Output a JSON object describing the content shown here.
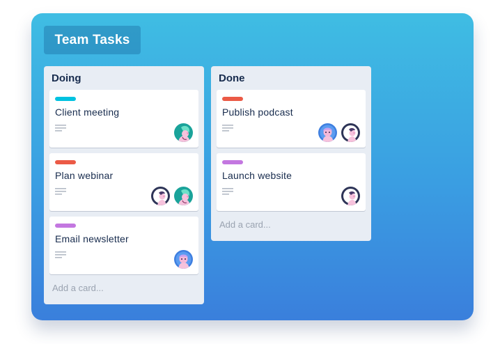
{
  "board": {
    "title": "Team Tasks"
  },
  "lists": [
    {
      "title": "Doing",
      "add_card": "Add a card...",
      "cards": [
        {
          "title": "Client meeting",
          "label_color": "#00c2e0",
          "has_description": true,
          "members": [
            "teal-avatar"
          ]
        },
        {
          "title": "Plan webinar",
          "label_color": "#eb5a46",
          "has_description": true,
          "members": [
            "dark-avatar",
            "teal-avatar"
          ]
        },
        {
          "title": "Email newsletter",
          "label_color": "#c377e0",
          "has_description": true,
          "members": [
            "blue-avatar"
          ]
        }
      ]
    },
    {
      "title": "Done",
      "add_card": "Add a card...",
      "cards": [
        {
          "title": "Publish podcast",
          "label_color": "#eb5a46",
          "has_description": true,
          "members": [
            "blue-avatar",
            "dark-avatar"
          ]
        },
        {
          "title": "Launch website",
          "label_color": "#c377e0",
          "has_description": true,
          "members": [
            "dark-avatar"
          ]
        }
      ]
    }
  ],
  "icons": {
    "description": "description-lines-icon"
  },
  "colors": {
    "board_gradient_top": "#3fbde3",
    "board_gradient_bottom": "#3a7fdc",
    "list_background": "#e8edf4",
    "text_dark": "#172b4d",
    "text_muted": "#9aa3b0"
  }
}
